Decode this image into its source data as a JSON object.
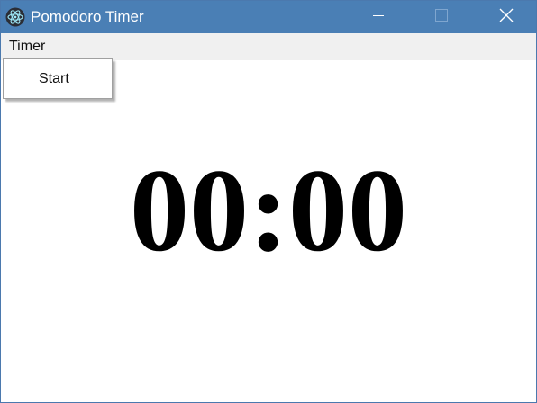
{
  "window": {
    "title": "Pomodoro Timer",
    "icon": "electron-atom-icon",
    "controls": {
      "minimize_icon": "minimize-icon",
      "maximize_icon": "maximize-icon",
      "close_icon": "close-icon"
    }
  },
  "menubar": {
    "items": [
      {
        "label": "Timer"
      }
    ]
  },
  "dropdown": {
    "items": [
      {
        "label": "Start"
      }
    ]
  },
  "timer": {
    "display": "00:00"
  },
  "colors": {
    "titlebar": "#4a7fb5",
    "menubar": "#f0f0f0",
    "background": "#ffffff",
    "timer_text": "#000000"
  }
}
